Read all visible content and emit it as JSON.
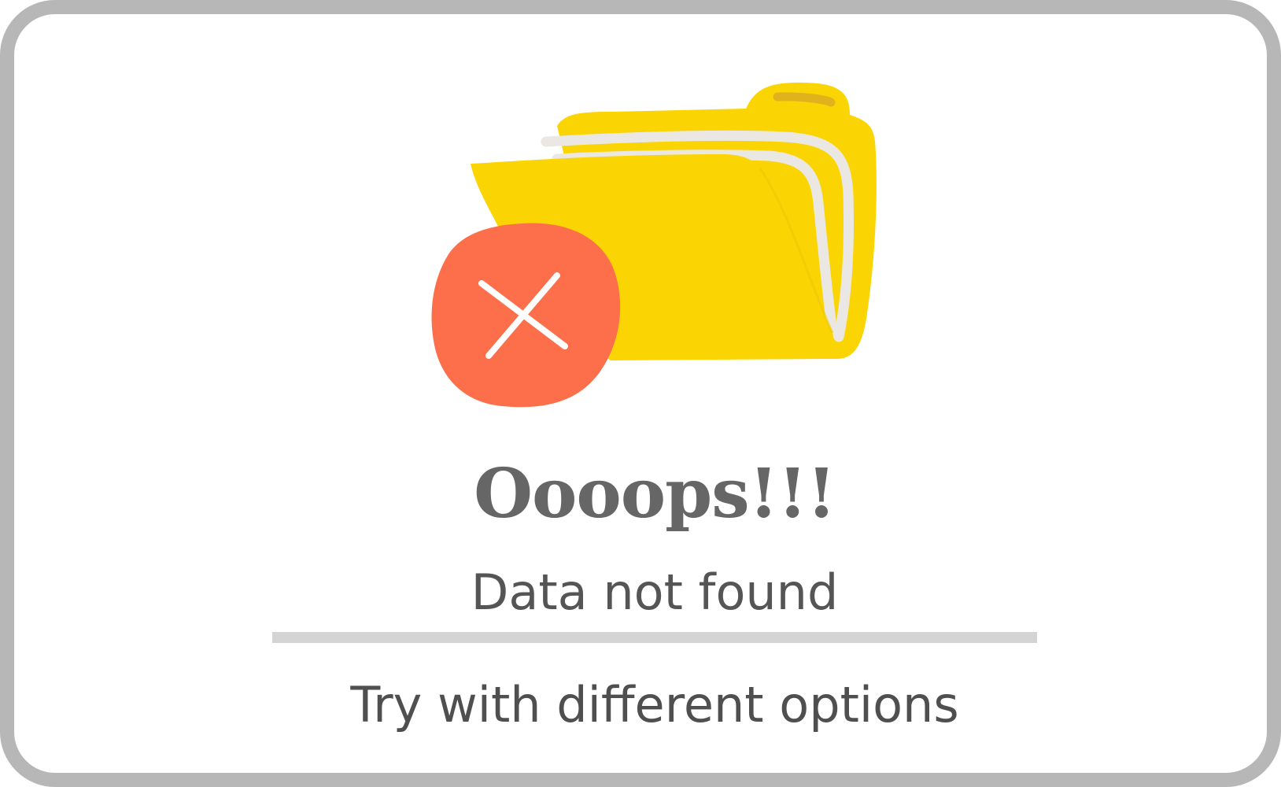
{
  "empty_state": {
    "title": "Oooops!!!",
    "message": "Data not found",
    "hint": "Try with different options"
  },
  "colors": {
    "frame_border": "#b7b7b7",
    "folder": "#fbd404",
    "folder_tab_stripe": "#e0b31d",
    "paper": "#ebe8e4",
    "error_badge": "#fd6f4a",
    "text_title": "#666666",
    "text_body": "#555555",
    "divider": "#d4d4d4"
  },
  "icons": {
    "folder": "folder-icon",
    "error": "close-icon"
  }
}
